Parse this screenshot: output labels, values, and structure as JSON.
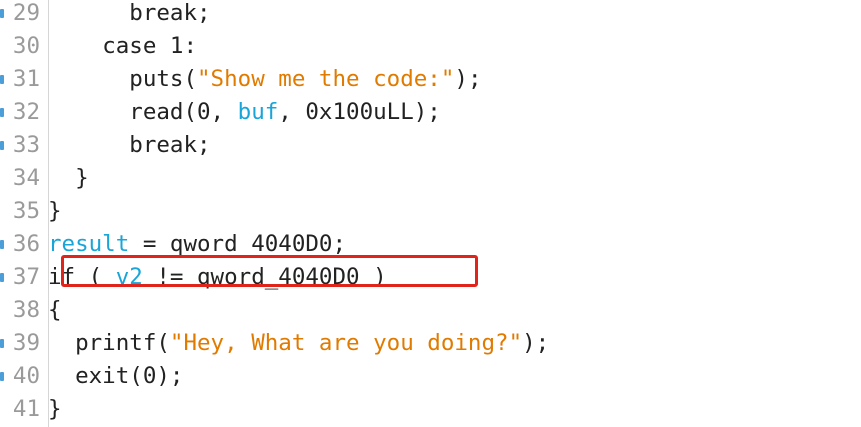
{
  "lines": [
    {
      "num": "29",
      "dot": true,
      "indent": "      ",
      "tokens": [
        {
          "t": "break;",
          "c": "plain"
        }
      ]
    },
    {
      "num": "30",
      "dot": false,
      "indent": "    ",
      "tokens": [
        {
          "t": "case 1:",
          "c": "plain"
        }
      ]
    },
    {
      "num": "31",
      "dot": true,
      "indent": "      ",
      "tokens": [
        {
          "t": "puts(",
          "c": "plain"
        },
        {
          "t": "\"Show me the code:\"",
          "c": "orange"
        },
        {
          "t": ");",
          "c": "plain"
        }
      ]
    },
    {
      "num": "32",
      "dot": true,
      "indent": "      ",
      "tokens": [
        {
          "t": "read(0, ",
          "c": "plain"
        },
        {
          "t": "buf",
          "c": "cyan"
        },
        {
          "t": ", 0x100uLL);",
          "c": "plain"
        }
      ]
    },
    {
      "num": "33",
      "dot": true,
      "indent": "      ",
      "tokens": [
        {
          "t": "break;",
          "c": "plain"
        }
      ]
    },
    {
      "num": "34",
      "dot": false,
      "indent": "  ",
      "tokens": [
        {
          "t": "}",
          "c": "plain"
        }
      ]
    },
    {
      "num": "35",
      "dot": false,
      "indent": "",
      "tokens": [
        {
          "t": "}",
          "c": "plain"
        }
      ]
    },
    {
      "num": "36",
      "dot": true,
      "indent": "",
      "tokens": [
        {
          "t": "result",
          "c": "cyan"
        },
        {
          "t": " = qword_4040D0;",
          "c": "plain"
        }
      ]
    },
    {
      "num": "37",
      "dot": true,
      "indent": "",
      "tokens": [
        {
          "t": "if ( ",
          "c": "plain"
        },
        {
          "t": "v2",
          "c": "cyan"
        },
        {
          "t": " != qword_4040D0 )",
          "c": "plain"
        }
      ]
    },
    {
      "num": "38",
      "dot": false,
      "indent": "",
      "tokens": [
        {
          "t": "{",
          "c": "plain"
        }
      ]
    },
    {
      "num": "39",
      "dot": true,
      "indent": "  ",
      "tokens": [
        {
          "t": "printf(",
          "c": "plain"
        },
        {
          "t": "\"Hey, What are you doing?\"",
          "c": "orange"
        },
        {
          "t": ");",
          "c": "plain"
        }
      ]
    },
    {
      "num": "40",
      "dot": true,
      "indent": "  ",
      "tokens": [
        {
          "t": "exit(0);",
          "c": "plain"
        }
      ]
    },
    {
      "num": "41",
      "dot": false,
      "indent": "",
      "tokens": [
        {
          "t": "}",
          "c": "plain"
        }
      ]
    }
  ],
  "highlight": {
    "line": "37",
    "color": "#e0241b"
  },
  "colors": {
    "identifier": "#1aa5d8",
    "string": "#e07b00",
    "text": "#222222",
    "line_number": "#9a9a9a",
    "breakpoint_marker": "#4c9ed9"
  }
}
